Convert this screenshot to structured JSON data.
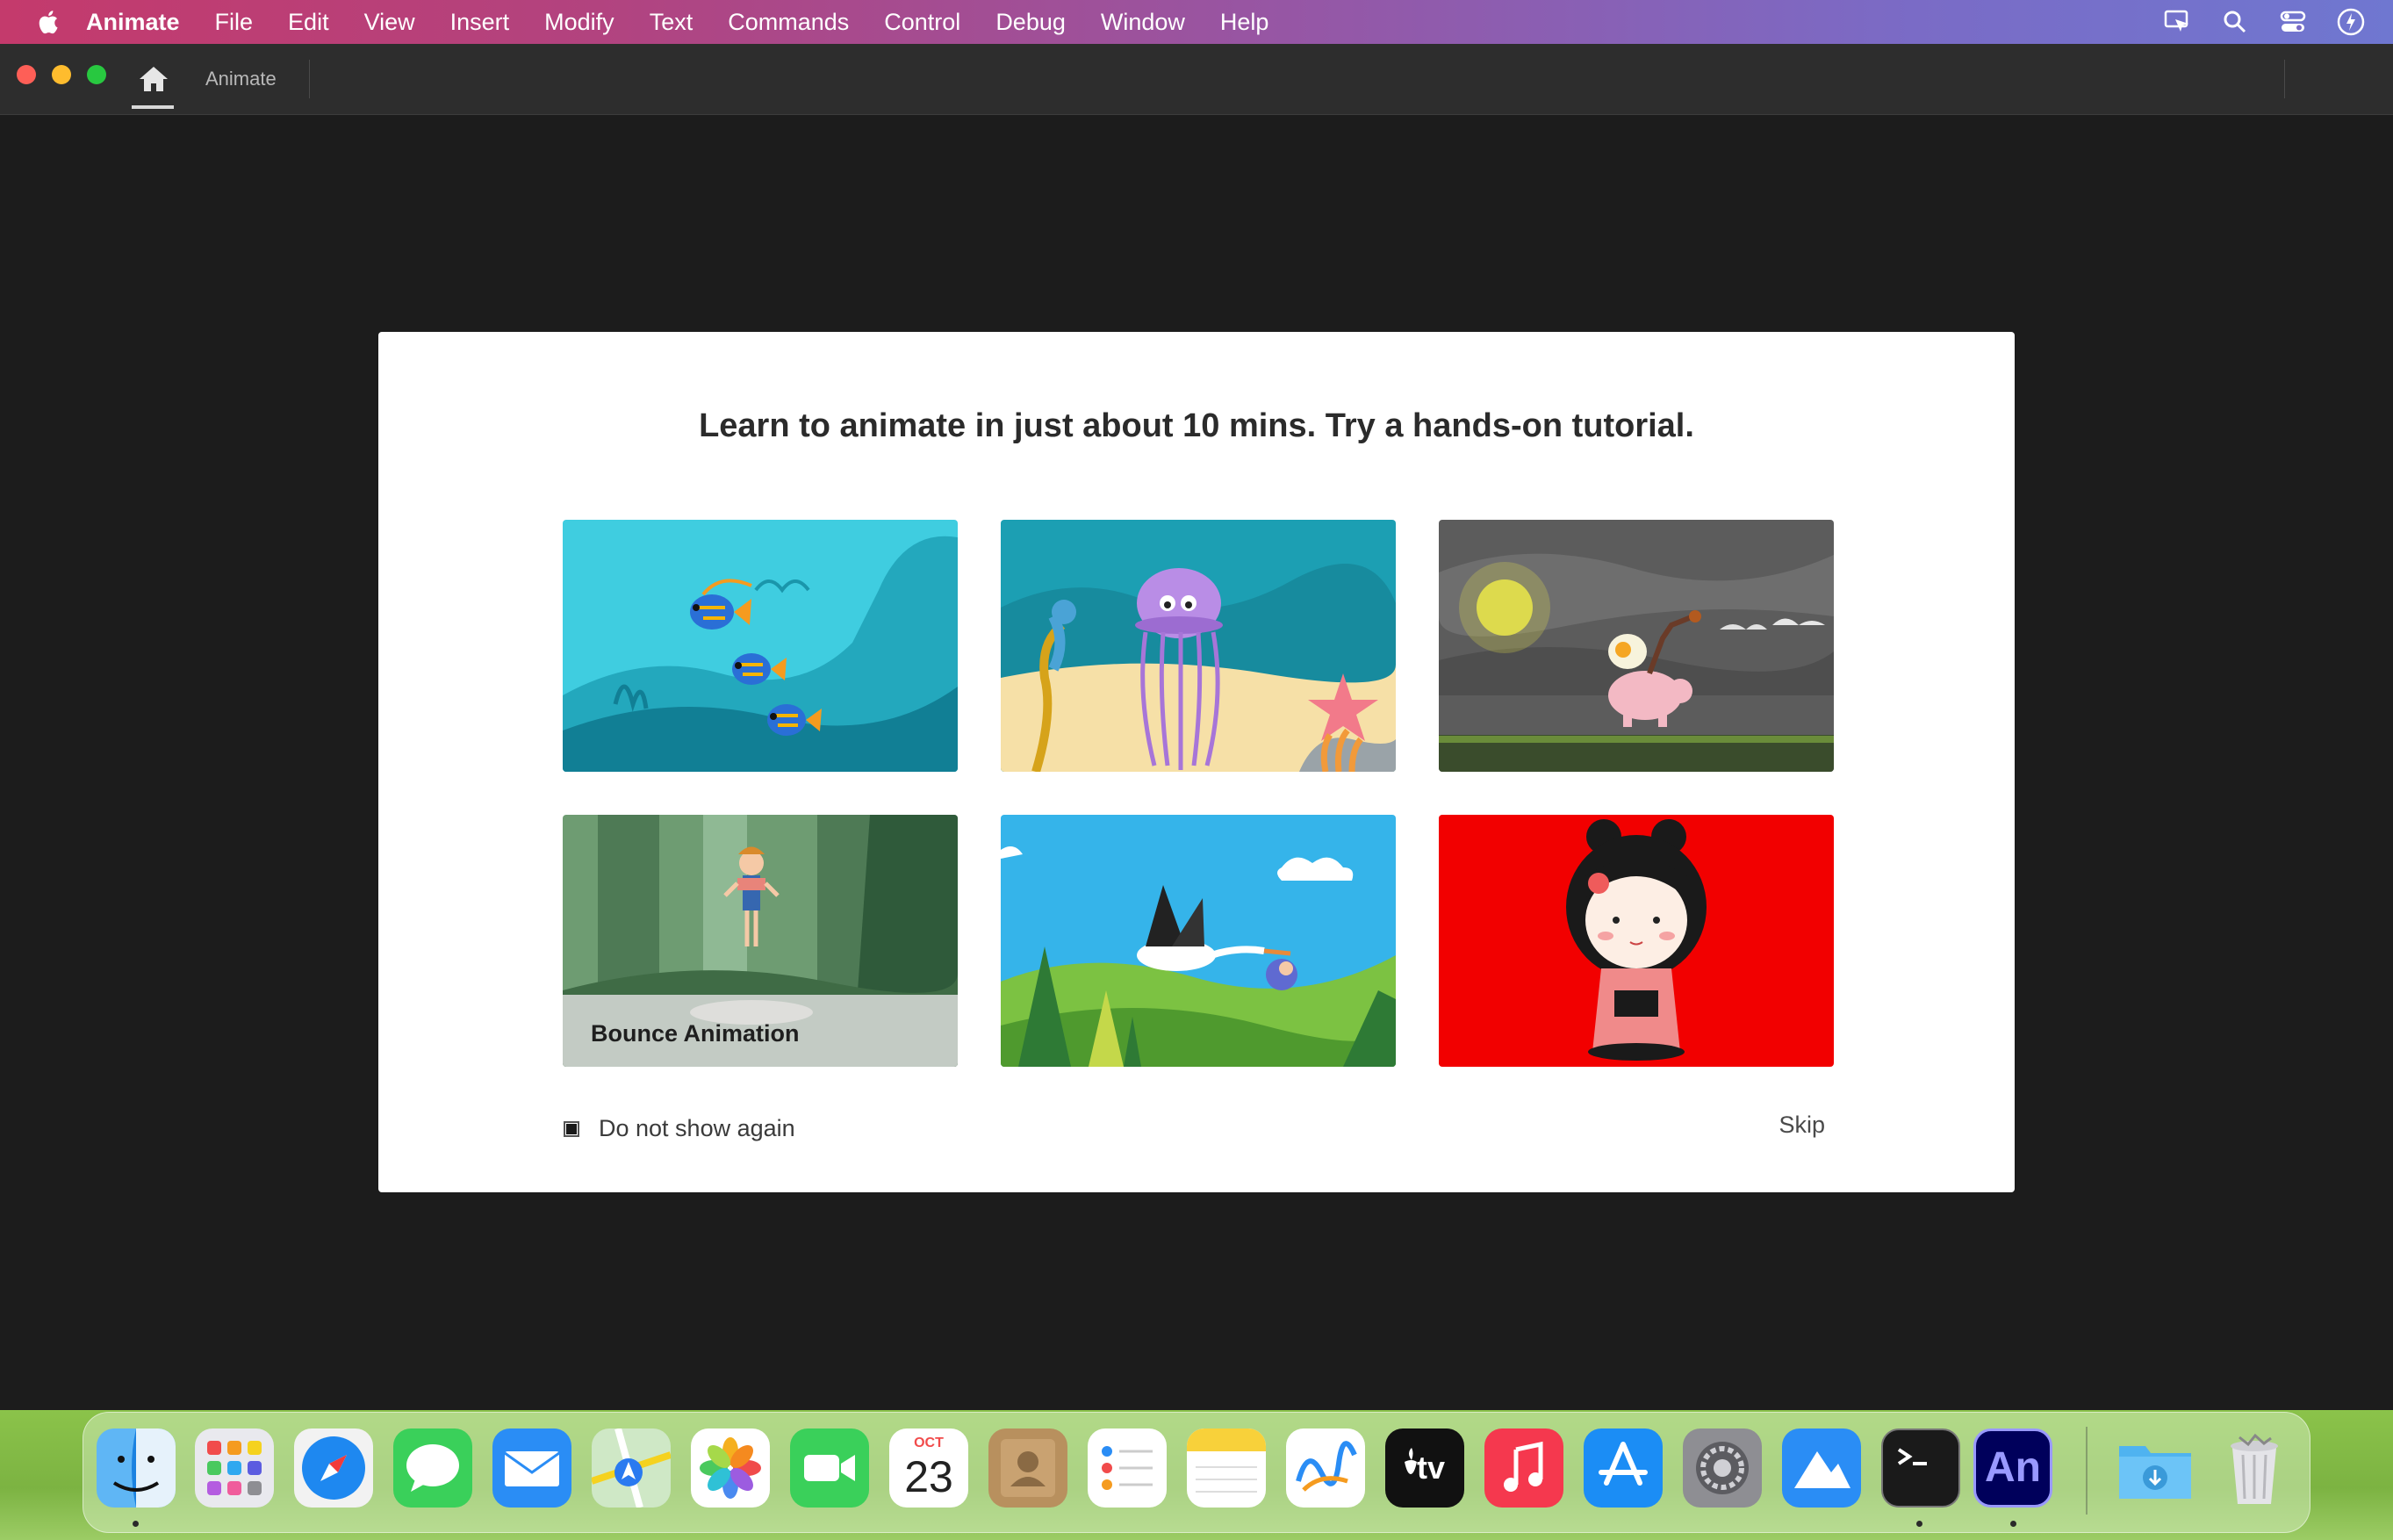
{
  "menubar": {
    "app_name": "Animate",
    "items": [
      "File",
      "Edit",
      "View",
      "Insert",
      "Modify",
      "Text",
      "Commands",
      "Control",
      "Debug",
      "Window",
      "Help"
    ],
    "right_icons": [
      "screen-mirror-icon",
      "search-icon",
      "control-center-icon",
      "siri-icon"
    ]
  },
  "titlebar": {
    "home_icon": "home-icon",
    "tab_label": "Animate"
  },
  "dialog": {
    "headline": "Learn to animate in just about 10 mins. Try a hands-on tutorial.",
    "tutorials": [
      {
        "name": "fish-tutorial",
        "caption": ""
      },
      {
        "name": "jellyfish-tutorial",
        "caption": ""
      },
      {
        "name": "pig-rider-tutorial",
        "caption": ""
      },
      {
        "name": "bounce-animation-tutorial",
        "caption": "Bounce Animation"
      },
      {
        "name": "stork-tutorial",
        "caption": ""
      },
      {
        "name": "doll-tutorial",
        "caption": ""
      }
    ],
    "checkbox_label": "Do not show again",
    "checkbox_checked": true,
    "skip_label": "Skip"
  },
  "dock": {
    "apps": [
      "Finder",
      "Launchpad",
      "Safari",
      "Messages",
      "Mail",
      "Maps",
      "Photos",
      "FaceTime",
      "Calendar",
      "Contacts",
      "Reminders",
      "Notes",
      "Freeform",
      "TV",
      "Music",
      "App Store",
      "System Settings",
      "Xcode Instruments",
      "Terminal",
      "Animate",
      "Downloads",
      "Trash"
    ],
    "calendar": {
      "month": "OCT",
      "day": "23"
    },
    "animate_label": "An",
    "tv_label": "tv"
  },
  "colors": {
    "workspace_bg": "#1c1c1c",
    "dialog_bg": "#ffffff",
    "animate_brand": "#00005b",
    "animate_text": "#9999ff"
  }
}
